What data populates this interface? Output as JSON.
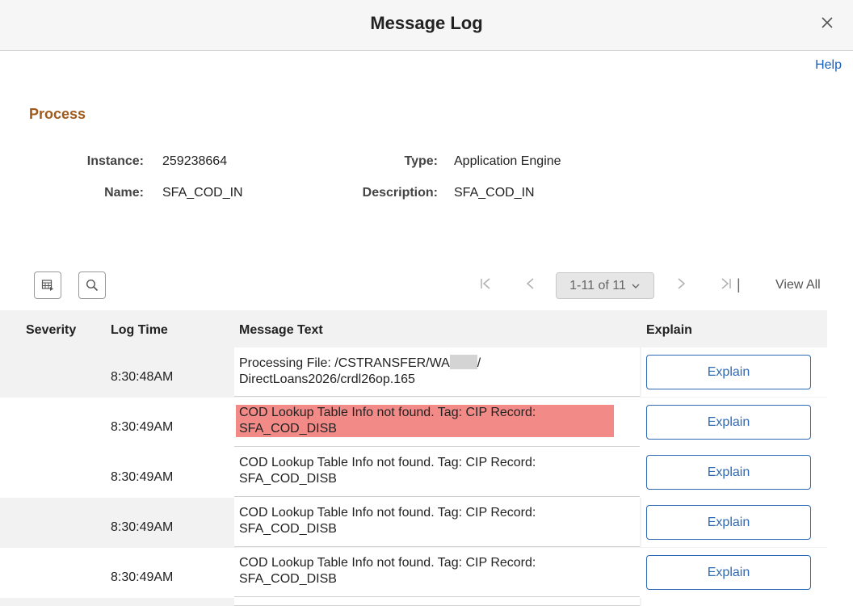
{
  "dialog": {
    "title": "Message Log",
    "close_icon": "close-icon",
    "help_label": "Help"
  },
  "process": {
    "section_title": "Process",
    "instance_label": "Instance:",
    "instance_value": "259238664",
    "type_label": "Type:",
    "type_value": "Application Engine",
    "name_label": "Name:",
    "name_value": "SFA_COD_IN",
    "description_label": "Description:",
    "description_value": "SFA_COD_IN"
  },
  "toolbar": {
    "personalize_icon": "grid-settings-icon",
    "search_icon": "search-icon"
  },
  "pager": {
    "first_icon": "first-page-icon",
    "prev_icon": "prev-page-icon",
    "range": "1-11 of 11",
    "next_icon": "next-page-icon",
    "last_icon": "last-page-icon",
    "separator": "|",
    "view_all": "View All"
  },
  "table": {
    "columns": [
      "Severity",
      "Log Time",
      "Message Text",
      "Explain"
    ],
    "rows": [
      {
        "severity": "",
        "time": "8:30:48AM",
        "msg_line1": "Processing File: /CSTRANSFER/WA",
        "msg_line1_suffix": "/",
        "msg_line2": "DirectLoans2026/crdl26op.165",
        "explain": "Explain",
        "highlight": false
      },
      {
        "severity": "",
        "time": "8:30:49AM",
        "msg_line1": "COD Lookup Table Info not found.  Tag: CIP Record:",
        "msg_line2": "SFA_COD_DISB",
        "explain": "Explain",
        "highlight": true
      },
      {
        "severity": "",
        "time": "8:30:49AM",
        "msg_line1": "COD Lookup Table Info not found.  Tag: CIP Record:",
        "msg_line2": "SFA_COD_DISB",
        "explain": "Explain",
        "highlight": false
      },
      {
        "severity": "",
        "time": "8:30:49AM",
        "msg_line1": "COD Lookup Table Info not found.  Tag: CIP Record:",
        "msg_line2": "SFA_COD_DISB",
        "explain": "Explain",
        "highlight": false
      },
      {
        "severity": "",
        "time": "8:30:49AM",
        "msg_line1": "COD Lookup Table Info not found.  Tag: CIP Record:",
        "msg_line2": "SFA_COD_DISB",
        "explain": "Explain",
        "highlight": false
      }
    ]
  },
  "colors": {
    "accent": "#2e69b5",
    "section_title": "#a05a1c",
    "error_highlight": "#f28b87"
  }
}
